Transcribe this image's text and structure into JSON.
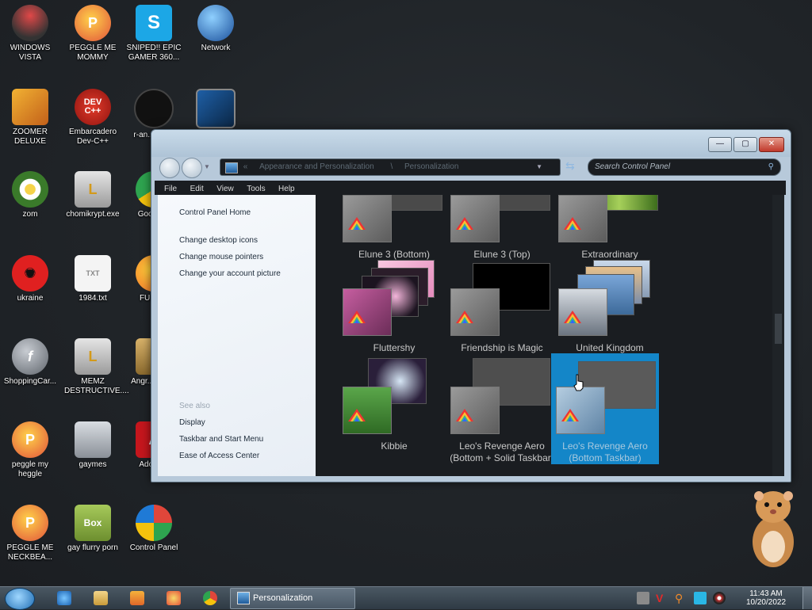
{
  "desktop": {
    "icons": [
      {
        "label": "WINDOWS VISTA"
      },
      {
        "label": "PEGGLE ME MOMMY"
      },
      {
        "label": "SNIPED!! EPIC GAMER 360..."
      },
      {
        "label": "Network"
      },
      {
        "label": "ZOOMER DELUXE"
      },
      {
        "label": "Embarcadero Dev-C++"
      },
      {
        "label": "r-an... par..."
      },
      {
        "label": ""
      },
      {
        "label": "zom"
      },
      {
        "label": "chomikrypt.exe"
      },
      {
        "label": "Google..."
      },
      {
        "label": "ukraine"
      },
      {
        "label": "1984.txt"
      },
      {
        "label": "FURR..."
      },
      {
        "label": "ShoppingCar..."
      },
      {
        "label": "MEMZ DESTRUCTIVE...."
      },
      {
        "label": "Angr... Sea..."
      },
      {
        "label": "peggle my heggle"
      },
      {
        "label": "gaymes"
      },
      {
        "label": "Adobe..."
      },
      {
        "label": "PEGGLE ME NECKBEA..."
      },
      {
        "label": "gay flurry porn"
      },
      {
        "label": "Control Panel"
      }
    ],
    "dev_text": "DEV C++",
    "box_text": "Box",
    "peggle_letter": "P",
    "adobe_letter": "A"
  },
  "window": {
    "title": "Personalization",
    "buttons": {
      "minimize": "—",
      "maximize": "▢",
      "close": "✕"
    },
    "address": {
      "separator": "«",
      "crumb1": "Appearance and Personalization",
      "crumb_sep": "\\",
      "crumb2": "Personalization"
    },
    "search_placeholder": "Search Control Panel",
    "menu": {
      "file": "File",
      "edit": "Edit",
      "view": "View",
      "tools": "Tools",
      "help": "Help"
    },
    "left_pane": {
      "home": "Control Panel Home",
      "links": [
        "Change desktop icons",
        "Change mouse pointers",
        "Change your account picture"
      ],
      "see_also": "See also",
      "see_links": [
        "Display",
        "Taskbar and Start Menu",
        "Ease of Access Center"
      ]
    },
    "themes": [
      {
        "name": "Elune 3 (Bottom)"
      },
      {
        "name": "Elune 3 (Top)"
      },
      {
        "name": "Extraordinary"
      },
      {
        "name": "Fluttershy"
      },
      {
        "name": "Friendship is Magic"
      },
      {
        "name": "United Kingdom"
      },
      {
        "name": "Kibbie"
      },
      {
        "name": "Leo's Revenge Aero (Bottom + Solid Taskbar)"
      },
      {
        "name": "Leo's Revenge Aero (Bottom Taskbar)"
      }
    ]
  },
  "taskbar": {
    "task_label": "Personalization",
    "time": "11:43 AM",
    "date": "10/20/2022"
  },
  "colors": {
    "selection": "#1486c8",
    "window_frame": "#b7c9da"
  }
}
